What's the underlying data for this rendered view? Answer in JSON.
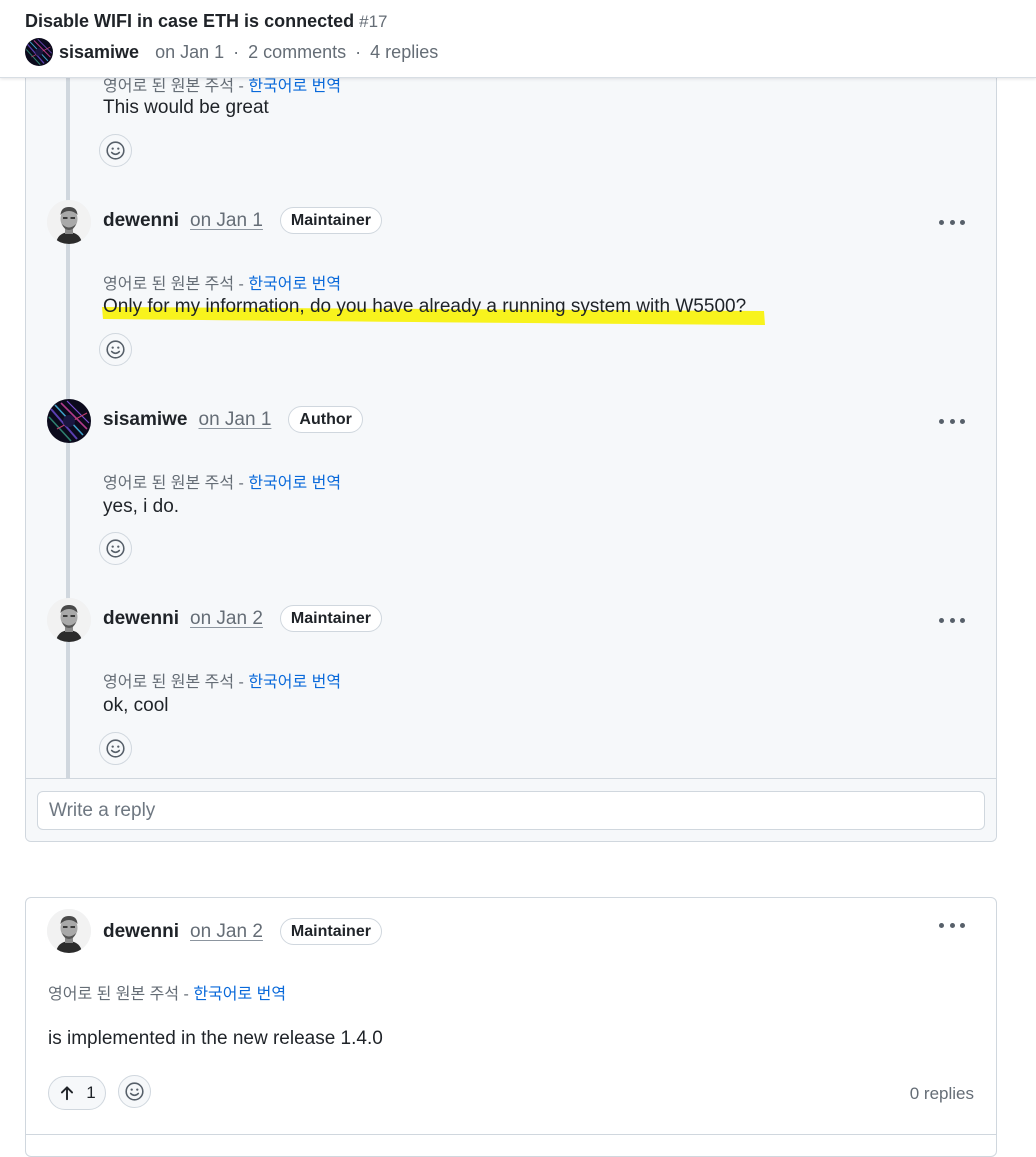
{
  "header": {
    "title": "Disable WIFI in case ETH is connected",
    "number": "#17",
    "author": "sisamiwe",
    "date": "on Jan 1",
    "comments": "2 comments",
    "replies": "4 replies",
    "separator": "·"
  },
  "thread": {
    "replies": [
      {
        "partial": true,
        "translation_prefix": "영어로 된 원본 주석 - ",
        "translation_link": "한국어로 번역",
        "body": "This would be great"
      },
      {
        "username": "dewenni",
        "date": "on Jan 1",
        "badge": "Maintainer",
        "translation_prefix": "영어로 된 원본 주석 - ",
        "translation_link": "한국어로 번역",
        "body": "Only for my information, do you have already a running system with W5500?",
        "highlighted": true
      },
      {
        "username": "sisamiwe",
        "date": "on Jan 1",
        "badge": "Author",
        "translation_prefix": "영어로 된 원본 주석 - ",
        "translation_link": "한국어로 번역",
        "body": "yes, i do."
      },
      {
        "username": "dewenni",
        "date": "on Jan 2",
        "badge": "Maintainer",
        "translation_prefix": "영어로 된 원본 주석 - ",
        "translation_link": "한국어로 번역",
        "body": "ok, cool"
      }
    ],
    "reply_placeholder": "Write a reply"
  },
  "comment": {
    "username": "dewenni",
    "date": "on Jan 2",
    "badge": "Maintainer",
    "translation_prefix": "영어로 된 원본 주석 - ",
    "translation_link": "한국어로 번역",
    "body": "is implemented in the new release 1.4.0",
    "upvotes": "1",
    "replies": "0 replies"
  },
  "colors": {
    "link": "#0969da",
    "muted": "#656d76",
    "highlight": "#f5f20a",
    "border": "#d0d7de"
  },
  "icons": [
    "smiley-icon",
    "kebab-horizontal-icon",
    "arrow-up-icon"
  ]
}
